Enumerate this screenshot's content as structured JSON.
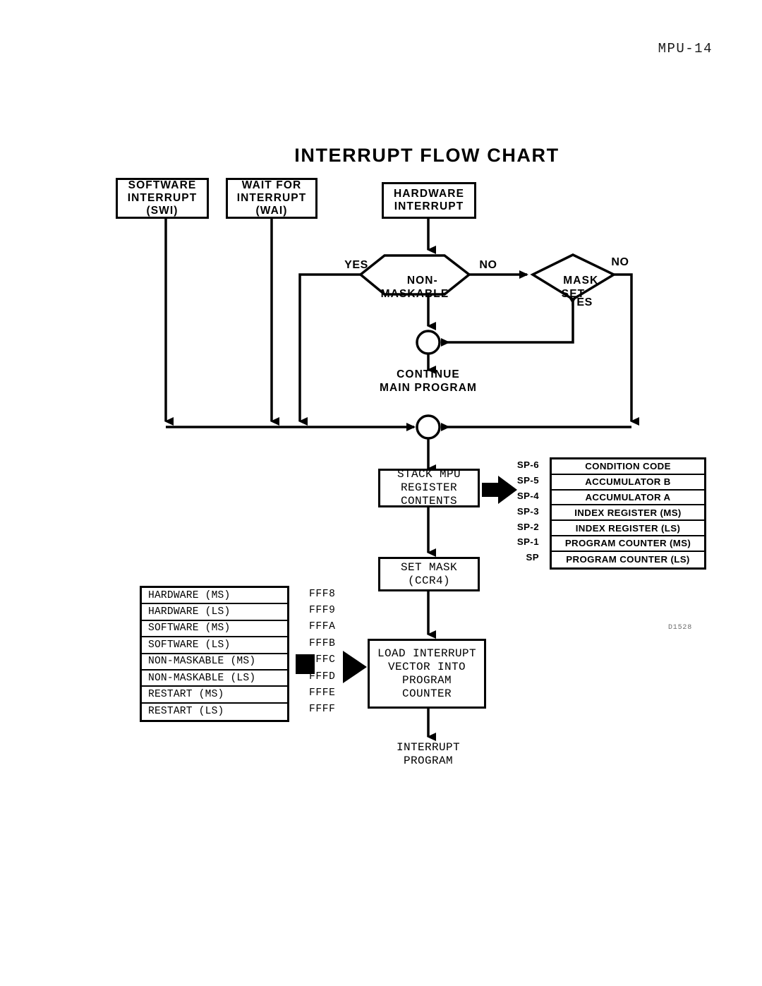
{
  "page": {
    "header": "MPU-14",
    "figure_id": "D1528"
  },
  "chart_data": {
    "type": "diagram",
    "title": "INTERRUPT FLOW CHART",
    "diagram_kind": "flowchart",
    "nodes": [
      {
        "id": "swi",
        "shape": "terminator",
        "text": "SOFTWARE\nINTERRUPT\n(SWI)"
      },
      {
        "id": "wai",
        "shape": "terminator",
        "text": "WAIT FOR\nINTERRUPT\n(WAI)"
      },
      {
        "id": "hw",
        "shape": "terminator",
        "text": "HARDWARE\nINTERRUPT"
      },
      {
        "id": "nonmask",
        "shape": "hexagon",
        "text": "NON-\nMASKABLE"
      },
      {
        "id": "maskset",
        "shape": "diamond",
        "text": "MASK\nSET"
      },
      {
        "id": "conn1",
        "shape": "connector",
        "text": ""
      },
      {
        "id": "continue",
        "shape": "label",
        "text": "CONTINUE\nMAIN PROGRAM"
      },
      {
        "id": "conn2",
        "shape": "connector",
        "text": ""
      },
      {
        "id": "stack",
        "shape": "process",
        "text": "STACK MPU\nREGISTER\nCONTENTS"
      },
      {
        "id": "setmask",
        "shape": "process",
        "text": "SET MASK\n(CCR4)"
      },
      {
        "id": "loadvec",
        "shape": "process",
        "text": "LOAD INTERRUPT\nVECTOR INTO\nPROGRAM\nCOUNTER"
      },
      {
        "id": "intprog",
        "shape": "label",
        "text": "INTERRUPT\nPROGRAM"
      }
    ],
    "edges": [
      {
        "from": "swi",
        "to": "bus",
        "label": ""
      },
      {
        "from": "wai",
        "to": "bus",
        "label": ""
      },
      {
        "from": "hw",
        "to": "nonmask",
        "label": ""
      },
      {
        "from": "nonmask",
        "to": "bus",
        "label": "YES"
      },
      {
        "from": "nonmask",
        "to": "maskset",
        "label": "NO"
      },
      {
        "from": "maskset",
        "to": "bus",
        "label": "NO"
      },
      {
        "from": "maskset",
        "to": "conn1",
        "label": "YES"
      },
      {
        "from": "conn1",
        "to": "continue",
        "label": ""
      },
      {
        "from": "conn2",
        "to": "stack",
        "label": ""
      },
      {
        "from": "stack",
        "to": "setmask",
        "label": ""
      },
      {
        "from": "setmask",
        "to": "loadvec",
        "label": ""
      },
      {
        "from": "loadvec",
        "to": "intprog",
        "label": ""
      },
      {
        "from": "stack",
        "to": "stack_table",
        "label": ""
      },
      {
        "from": "vector_table",
        "to": "loadvec",
        "label": ""
      }
    ]
  },
  "nodes": {
    "software_interrupt": {
      "line1": "SOFTWARE",
      "line2": "INTERRUPT",
      "line3": "(SWI)"
    },
    "wait_for_interrupt": {
      "line1": "WAIT FOR",
      "line2": "INTERRUPT",
      "line3": "(WAI)"
    },
    "hardware_interrupt": {
      "line1": "HARDWARE",
      "line2": "INTERRUPT"
    },
    "non_maskable": "NON-\nMASKABLE",
    "mask_set": "MASK\nSET",
    "continue_main_program": "CONTINUE\nMAIN PROGRAM",
    "stack_mpu": "STACK MPU\nREGISTER\nCONTENTS",
    "set_mask": "SET MASK\n(CCR4)",
    "load_vector": "LOAD INTERRUPT\nVECTOR INTO\nPROGRAM\nCOUNTER",
    "interrupt_program": "INTERRUPT\nPROGRAM"
  },
  "branch_labels": {
    "nonmaskable_yes": "YES",
    "nonmaskable_no": "NO",
    "maskset_no": "NO",
    "maskset_yes": "YES"
  },
  "stack_table": {
    "rows": [
      {
        "pointer": "SP-6",
        "register": "CONDITION CODE"
      },
      {
        "pointer": "SP-5",
        "register": "ACCUMULATOR B"
      },
      {
        "pointer": "SP-4",
        "register": "ACCUMULATOR A"
      },
      {
        "pointer": "SP-3",
        "register": "INDEX REGISTER (MS)"
      },
      {
        "pointer": "SP-2",
        "register": "INDEX REGISTER (LS)"
      },
      {
        "pointer": "SP-1",
        "register": "PROGRAM COUNTER (MS)"
      },
      {
        "pointer": "SP",
        "register": "PROGRAM COUNTER (LS)"
      }
    ]
  },
  "vector_table": {
    "rows": [
      {
        "vector": "HARDWARE  (MS)",
        "address": "FFF8"
      },
      {
        "vector": "HARDWARE  (LS)",
        "address": "FFF9"
      },
      {
        "vector": "SOFTWARE  (MS)",
        "address": "FFFA"
      },
      {
        "vector": "SOFTWARE  (LS)",
        "address": "FFFB"
      },
      {
        "vector": "NON-MASKABLE  (MS)",
        "address": "FFFC"
      },
      {
        "vector": "NON-MASKABLE  (LS)",
        "address": "FFFD"
      },
      {
        "vector": "RESTART  (MS)",
        "address": "FFFE"
      },
      {
        "vector": "RESTART  (LS)",
        "address": "FFFF"
      }
    ]
  }
}
